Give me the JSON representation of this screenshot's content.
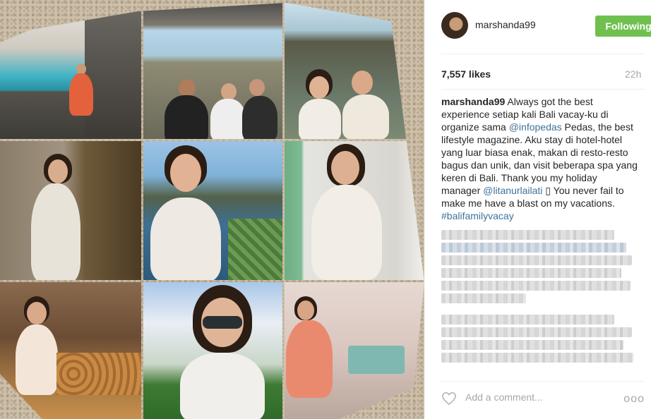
{
  "post": {
    "username": "marshanda99",
    "follow_label": "Following",
    "likes": "7,557 likes",
    "time": "22h",
    "caption": {
      "username": "marshanda99",
      "text_1": " Always got the best experience setiap kali Bali vacay-ku di organize sama ",
      "mention_1": "@infopedas",
      "text_2": " Pedas, the best lifestyle magazine. Aku stay di hotel-hotel yang luar biasa enak, makan di resto-resto bagus dan unik, dan visit beberapa spa yang keren di Bali. Thank you my holiday manager ",
      "mention_2": "@litanurlailati",
      "text_3": " ▯ You never fail to make me have a blast on my vacations. ",
      "hashtag": "#balifamilyvacay"
    },
    "comment_placeholder": "Add a comment...",
    "more_label": "ooo"
  },
  "icons": {
    "heart": "heart-outline-icon",
    "more": "more-options-icon"
  },
  "colors": {
    "follow_button": "#70c050",
    "link": "#3f729b",
    "muted": "#a5a7aa",
    "text": "#262626"
  }
}
